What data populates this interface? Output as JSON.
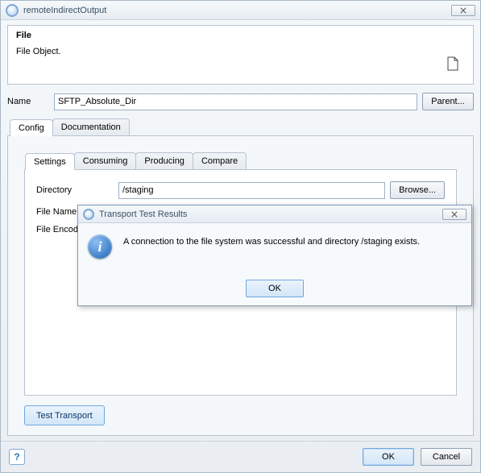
{
  "window": {
    "title": "remoteIndirectOutput"
  },
  "description": {
    "heading": "File",
    "text": "File Object."
  },
  "name": {
    "label": "Name",
    "value": "SFTP_Absolute_Dir",
    "parent_label": "Parent..."
  },
  "tabs": {
    "config": "Config",
    "documentation": "Documentation"
  },
  "inner_tabs": {
    "settings": "Settings",
    "consuming": "Consuming",
    "producing": "Producing",
    "compare": "Compare"
  },
  "settings": {
    "directory_label": "Directory",
    "directory_value": "/staging",
    "browse_label": "Browse...",
    "file_name_label": "File Name",
    "file_encoding_label": "File Encod"
  },
  "buttons": {
    "test_transport": "Test Transport",
    "ok": "OK",
    "cancel": "Cancel"
  },
  "modal": {
    "title": "Transport Test Results",
    "message": "A connection to the file system was successful and directory /staging exists.",
    "ok": "OK"
  }
}
